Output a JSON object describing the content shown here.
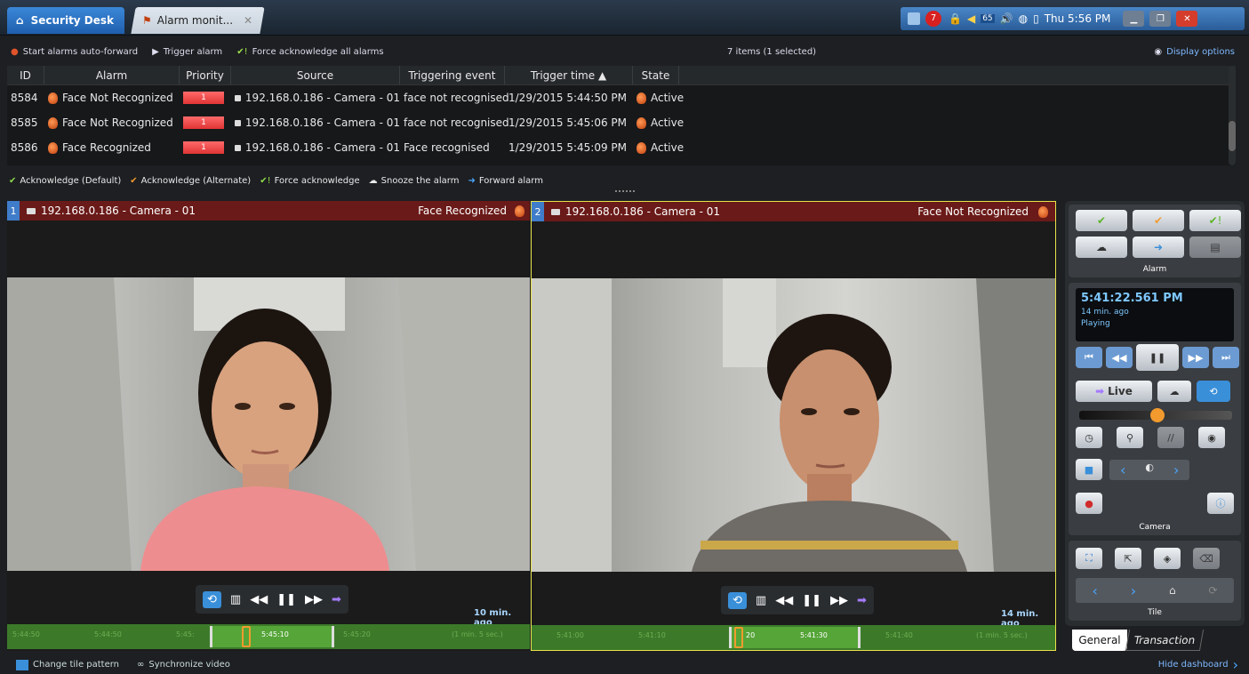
{
  "titlebar": {
    "tab1": "Security Desk",
    "tab2": "Alarm monit...",
    "alarm_count": "7",
    "volume_level": "65",
    "clock": "Thu 5:56 PM"
  },
  "toolbar": {
    "auto_forward": "Start alarms auto-forward",
    "trigger": "Trigger alarm",
    "force_ack_all": "Force acknowledge all alarms",
    "items": "7 items (1 selected)",
    "display_options": "Display options"
  },
  "grid": {
    "columns": [
      "ID",
      "Alarm",
      "Priority",
      "Source",
      "Triggering event",
      "Trigger time ▲",
      "State"
    ],
    "rows": [
      {
        "id": "8584",
        "alarm": "Face Not Recognized",
        "priority": "1",
        "source": "192.168.0.186 - Camera - 01",
        "event": "face not recognised",
        "time": "1/29/2015 5:44:50 PM",
        "state": "Active"
      },
      {
        "id": "8585",
        "alarm": "Face Not Recognized",
        "priority": "1",
        "source": "192.168.0.186 - Camera - 01",
        "event": "face not recognised",
        "time": "1/29/2015 5:45:06 PM",
        "state": "Active"
      },
      {
        "id": "8586",
        "alarm": "Face Recognized",
        "priority": "1",
        "source": "192.168.0.186 - Camera - 01",
        "event": "Face recognised",
        "time": "1/29/2015 5:45:09 PM",
        "state": "Active"
      }
    ]
  },
  "actions": {
    "ack_default": "Acknowledge (Default)",
    "ack_alt": "Acknowledge (Alternate)",
    "force_ack": "Force acknowledge",
    "snooze": "Snooze the alarm",
    "forward": "Forward alarm"
  },
  "tiles": [
    {
      "num": "1",
      "source": "192.168.0.186 - Camera - 01",
      "alarm": "Face Recognized",
      "ago": "10 min. ago",
      "ticks": [
        "5:44:50",
        "5:44:50",
        "5:45:",
        "5:45:10",
        "5:45:20",
        "(1 min. 5 sec.)"
      ]
    },
    {
      "num": "2",
      "source": "192.168.0.186 - Camera - 01",
      "alarm": "Face Not Recognized",
      "ago": "14 min. ago",
      "ticks": [
        "5:41:00",
        "5:41:10",
        "20",
        "5:41:30",
        "5:41:40",
        "(1 min. 5 sec.)"
      ]
    }
  ],
  "dashboard": {
    "alarm_label": "Alarm",
    "time": "5:41:22.561 PM",
    "ago": "14 min. ago",
    "status": "Playing",
    "live": "Live",
    "camera_label": "Camera",
    "tile_label": "Tile",
    "tab_general": "General",
    "tab_transaction": "Transaction",
    "playback_speed_fraction": 0.5
  },
  "bottom": {
    "change_tile": "Change tile pattern",
    "sync": "Synchronize video",
    "hide_dash": "Hide dashboard"
  },
  "colors": {
    "accent": "#3b87d8",
    "alarm_header": "#6a1a18",
    "priority": "#e03535",
    "timeline": "#3c7a2a"
  }
}
